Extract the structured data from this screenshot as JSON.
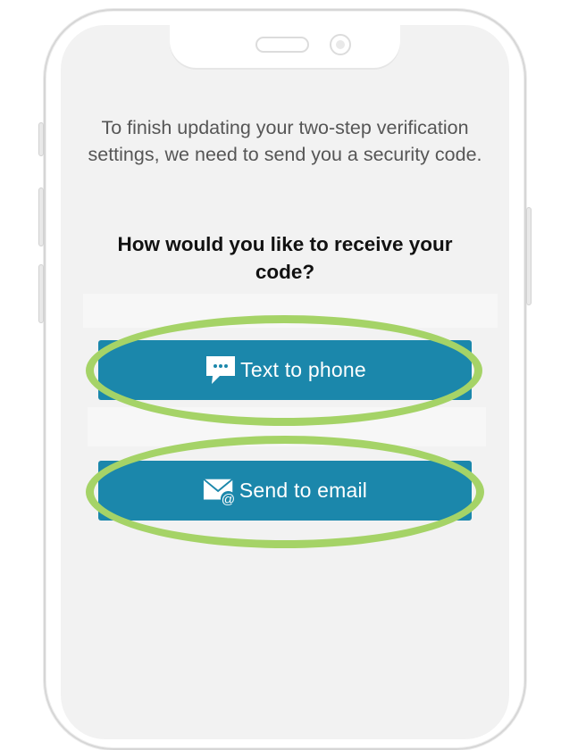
{
  "intro_text": "To finish updating your two-step verification settings, we need to send you a security code.",
  "question": "How would you like to receive your code?",
  "buttons": {
    "text_to_phone": {
      "label": "Text to phone",
      "icon": "chat-bubble-icon"
    },
    "send_to_email": {
      "label": "Send to email",
      "icon": "email-at-icon"
    }
  },
  "colors": {
    "button_background": "#1b87ab",
    "button_text": "#ffffff",
    "highlight": "#a5d367",
    "screen_background": "#f2f2f2",
    "intro_text": "#565656",
    "question_text": "#111111"
  }
}
